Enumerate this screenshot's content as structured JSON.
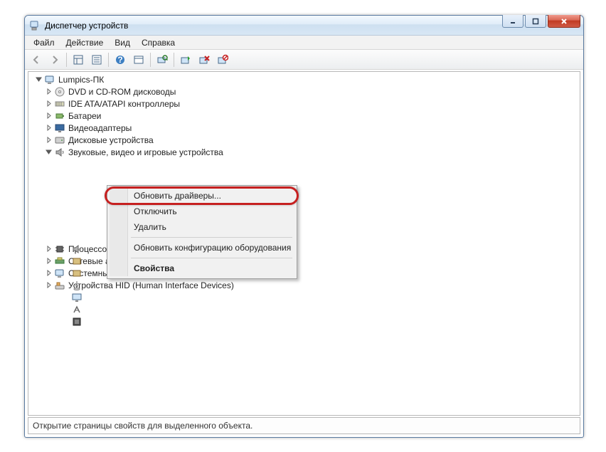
{
  "window": {
    "title": "Диспетчер устройств"
  },
  "menu": {
    "file": "Файл",
    "action": "Действие",
    "view": "Вид",
    "help": "Справка"
  },
  "tree": {
    "root": "Lumpics-ПК",
    "items": [
      "DVD и CD-ROM дисководы",
      "IDE ATA/ATAPI контроллеры",
      "Батареи",
      "Видеоадаптеры",
      "Дисковые устройства",
      "Звуковые, видео и игровые устройства",
      "Процессоры",
      "Сетевые адаптеры",
      "Системные устройства",
      "Устройства HID (Human Interface Devices)"
    ]
  },
  "context_menu": {
    "update": "Обновить драйверы...",
    "disable": "Отключить",
    "delete": "Удалить",
    "scan": "Обновить конфигурацию оборудования",
    "properties": "Свойства"
  },
  "status": "Открытие страницы свойств для выделенного объекта.",
  "icons": {
    "computer": "computer",
    "disc": "disc",
    "ide": "ide",
    "battery": "battery",
    "display": "display",
    "disk": "disk",
    "sound": "sound",
    "cpu": "cpu",
    "network": "network",
    "system": "system",
    "hid": "hid"
  }
}
